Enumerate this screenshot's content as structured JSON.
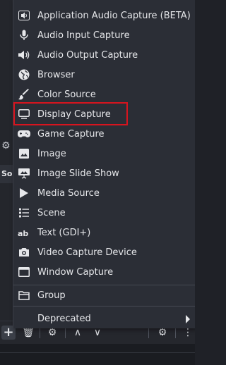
{
  "menu": {
    "items": [
      {
        "label": "Application Audio Capture (BETA)",
        "icon": "app-audio-icon"
      },
      {
        "label": "Audio Input Capture",
        "icon": "microphone-icon"
      },
      {
        "label": "Audio Output Capture",
        "icon": "speaker-icon"
      },
      {
        "label": "Browser",
        "icon": "globe-icon"
      },
      {
        "label": "Color Source",
        "icon": "brush-icon"
      },
      {
        "label": "Display Capture",
        "icon": "monitor-icon"
      },
      {
        "label": "Game Capture",
        "icon": "gamepad-icon"
      },
      {
        "label": "Image",
        "icon": "image-icon"
      },
      {
        "label": "Image Slide Show",
        "icon": "slideshow-icon"
      },
      {
        "label": "Media Source",
        "icon": "play-icon"
      },
      {
        "label": "Scene",
        "icon": "scene-list-icon"
      },
      {
        "label": "Text (GDI+)",
        "icon": "text-ab-icon"
      },
      {
        "label": "Video Capture Device",
        "icon": "camera-icon"
      },
      {
        "label": "Window Capture",
        "icon": "window-icon"
      },
      {
        "label": "Group",
        "icon": "folder-icon"
      },
      {
        "label": "Deprecated",
        "icon": ""
      }
    ],
    "highlighted_item": "Display Capture",
    "highlight_color": "#d8141e",
    "text_color": "#e6e7ea",
    "background_color": "#2b2e36"
  },
  "background": {
    "sources_tab_label": "So",
    "bottom_toolbar": {
      "add_label": "+",
      "remove_label": "🗑",
      "properties_label": "⚙",
      "up_label": "∧",
      "down_label": "∨",
      "settings_label": "⚙",
      "more_label": "⋮"
    }
  }
}
